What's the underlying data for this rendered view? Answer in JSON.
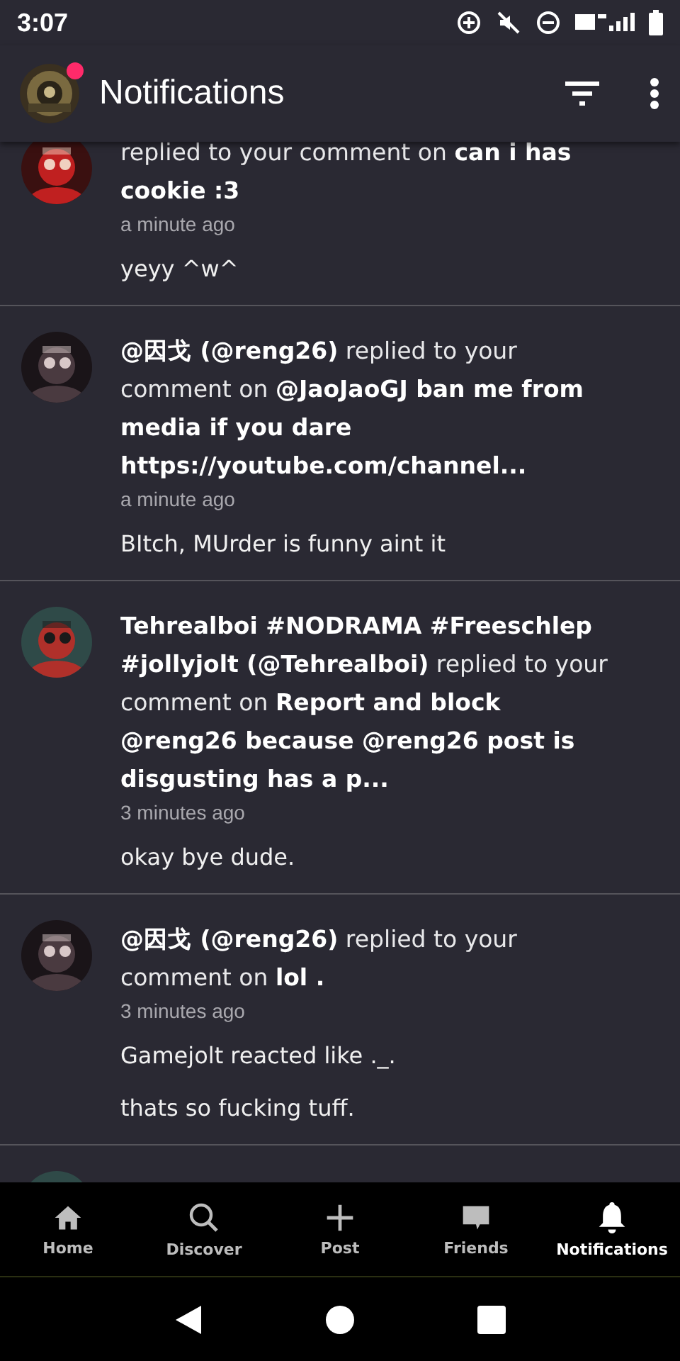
{
  "status_bar": {
    "time": "3:07"
  },
  "header": {
    "title": "Notifications",
    "avatar_badge": true
  },
  "notifications": [
    {
      "text": "replied to your comment on **can i has cookie :3**",
      "time": "a minute ago",
      "body": [
        "yeyy ^w^"
      ]
    },
    {
      "text": "**@因戈 (@reng26)** replied to your comment on **@JaoJaoGJ ban me from media if you dare https://youtube.com/channel...**",
      "time": "a minute ago",
      "body": [
        "BItch, MUrder is funny aint it"
      ]
    },
    {
      "text": "**Tehrealboi #NODRAMA #Freeschlep #jollyjolt (@Tehrealboi)** replied to your comment on **Report and block @reng26 because @reng26 post is disgusting has a p...**",
      "time": "3 minutes ago",
      "body": [
        "okay bye dude."
      ]
    },
    {
      "text": "**@因戈 (@reng26)** replied to your comment on **lol .**",
      "time": "3 minutes ago",
      "body": [
        "Gamejolt  reacted like ._.",
        "thats so fucking tuff."
      ]
    }
  ],
  "nav": [
    {
      "label": "Home",
      "selected": false
    },
    {
      "label": "Discover",
      "selected": false
    },
    {
      "label": "Post",
      "selected": false
    },
    {
      "label": "Friends",
      "selected": false
    },
    {
      "label": "Notifications",
      "selected": true
    }
  ]
}
